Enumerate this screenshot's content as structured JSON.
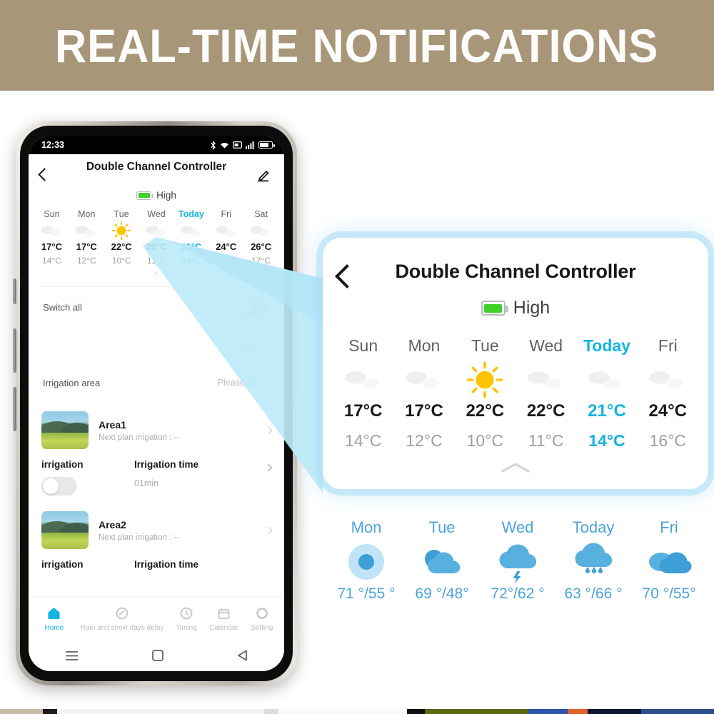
{
  "banner": {
    "title": "REAL-TIME NOTIFICATIONS",
    "bg_color": "#a89679",
    "text_color": "#fdfdfb"
  },
  "accent_color": "#15b4e0",
  "strip_color": "#4ba3d8",
  "phone": {
    "status_bar": {
      "time": "12:33",
      "icons": [
        "bluetooth-icon",
        "wifi-icon",
        "cast-icon",
        "signal-icon",
        "battery-icon"
      ]
    },
    "app_header": {
      "title": "Double Channel Controller",
      "back_icon": "back-chevron-icon",
      "edit_icon": "pencil-icon",
      "battery_label": "High"
    },
    "weather": {
      "days": [
        "Sun",
        "Mon",
        "Tue",
        "Wed",
        "Today",
        "Fri",
        "Sat"
      ],
      "icons": [
        "cloudy",
        "cloudy",
        "sunny",
        "cloudy",
        "cloudy",
        "cloudy",
        "cloudy"
      ],
      "highs": [
        "17°C",
        "17°C",
        "22°C",
        "22°C",
        "21°C",
        "24°C",
        "26°C"
      ],
      "lows": [
        "14°C",
        "12°C",
        "10°C",
        "11°C",
        "14°C",
        "16°C",
        "17°C"
      ],
      "today_index": 4
    },
    "rows": [
      {
        "label": "Switch all",
        "value": "",
        "control": "toggle"
      },
      {
        "label": "",
        "value": "order",
        "control": "chevron"
      },
      {
        "label": "Irrigation area",
        "value": "Please set",
        "control": "chevron"
      }
    ],
    "areas": [
      {
        "name": "Area1",
        "subtitle": "Next plan irrigation : --",
        "irrigation_label": "irrigation",
        "time_label": "Irrigation time",
        "time_value": "01min"
      },
      {
        "name": "Area2",
        "subtitle": "Next plan irrigation : --",
        "irrigation_label": "irrigation",
        "time_label": "Irrigation time",
        "time_value": ""
      }
    ],
    "tabs": [
      {
        "label": "Home",
        "icon": "home-icon",
        "active": true
      },
      {
        "label": "Rain and snow days delay",
        "icon": "rain-delay-icon",
        "active": false
      },
      {
        "label": "Timing",
        "icon": "clock-icon",
        "active": false
      },
      {
        "label": "Calendar",
        "icon": "calendar-icon",
        "active": false
      },
      {
        "label": "Setting",
        "icon": "gear-icon",
        "active": false
      }
    ],
    "nav_buttons": [
      "recents-icon",
      "home-square-icon",
      "back-triangle-icon"
    ]
  },
  "callout": {
    "title": "Double Channel Controller",
    "back_icon": "back-chevron-icon",
    "battery_label": "High",
    "days": [
      "Sun",
      "Mon",
      "Tue",
      "Wed",
      "Today",
      "Fri"
    ],
    "icons": [
      "cloudy",
      "cloudy",
      "sunny",
      "cloudy",
      "cloudy",
      "cloudy"
    ],
    "highs": [
      "17°C",
      "17°C",
      "22°C",
      "22°C",
      "21°C",
      "24°C"
    ],
    "lows": [
      "14°C",
      "12°C",
      "10°C",
      "11°C",
      "14°C",
      "16°C"
    ],
    "today_index": 4,
    "collapse_icon": "chevron-up-icon"
  },
  "forecast_strip": [
    {
      "day": "Mon",
      "icon": "sun-icon",
      "temp": "71 °/55 °"
    },
    {
      "day": "Tue",
      "icon": "partly-cloudy-icon",
      "temp": "69 °/48°"
    },
    {
      "day": "Wed",
      "icon": "thunderstorm-icon",
      "temp": "72°/62 °"
    },
    {
      "day": "Today",
      "icon": "rain-icon",
      "temp": "63 °/66 °"
    },
    {
      "day": "Fri",
      "icon": "cloudy-icon",
      "temp": "70 °/55°"
    }
  ]
}
